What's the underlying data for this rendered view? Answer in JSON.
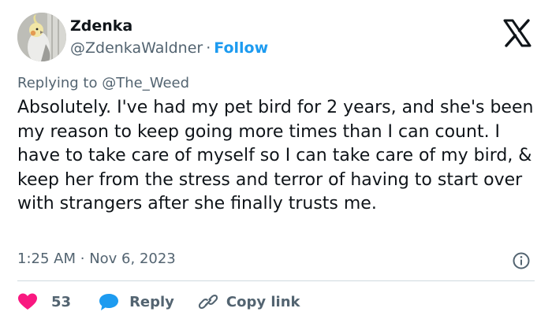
{
  "author": {
    "name": "Zdenka",
    "handle": "@ZdenkaWaldner",
    "separator": "·",
    "follow_label": "Follow",
    "avatar_icon": "cockatiel-avatar"
  },
  "brand": {
    "logo_icon": "x-logo-icon"
  },
  "reply_context": {
    "prefix": "Replying to",
    "mention": "@The_Weed"
  },
  "tweet": {
    "text": "Absolutely. I've had my pet bird for 2 years, and she's been my reason to keep going more times than I can count. I have to take care of myself so I can take care of my bird, & keep her from the stress and terror of having to start over with strangers after she finally trusts me.",
    "time": "1:25 AM",
    "separator": "·",
    "date": "Nov 6, 2023"
  },
  "actions": {
    "like_count": "53",
    "reply_label": "Reply",
    "copy_link_label": "Copy link"
  },
  "colors": {
    "accent": "#1d9bf0",
    "like": "#f91880",
    "secondary_text": "#536471",
    "primary_text": "#0f1419",
    "divider": "#cfd9de"
  }
}
